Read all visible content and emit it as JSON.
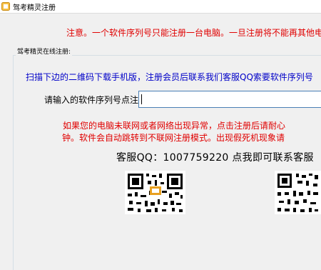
{
  "window": {
    "title": "驾考精灵注册",
    "icon": "app-icon"
  },
  "notice": "注意。一个软件序列号只能注册一台电脑。一旦注册将不能再其他电脑",
  "group": {
    "caption": "驾考精灵在线注册:",
    "scan_instruction": "扫描下边的二维码下载手机版，注册会员后联系我们客服QQ索要软件序列号"
  },
  "serial": {
    "label": "请输入的软件序列号点注册:",
    "value": ""
  },
  "warning": {
    "line1": "如果您的电脑未联网或者网络出现异常，点击注册后请耐心",
    "line2": "钟。软件会自动跳转到不联网注册模式。出现假死机现象请"
  },
  "service": "客服QQ：1007759220 点我即可联系客服",
  "qr_codes": [
    "qr-code-icon",
    "qr-code-icon"
  ],
  "colors": {
    "notice_red": "#e00000",
    "instruction_blue": "#0000c8",
    "input_border": "#4a7fb5"
  }
}
